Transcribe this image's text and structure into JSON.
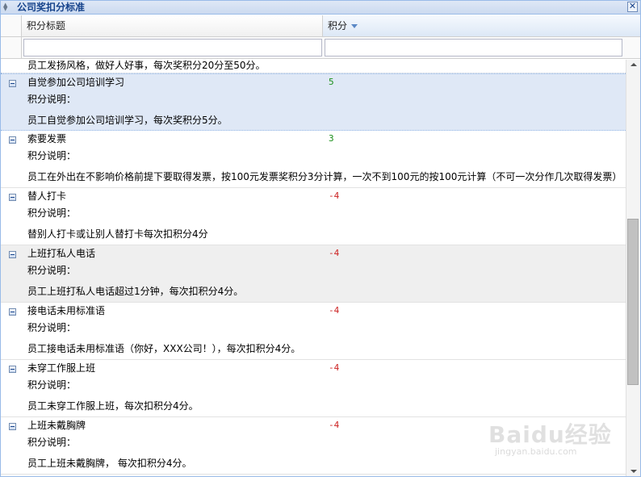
{
  "window": {
    "title": "公司奖扣分标准",
    "close_glyph": "✕"
  },
  "grid": {
    "columns": [
      {
        "label": "积分标题"
      },
      {
        "label": "积分",
        "sort": "descending"
      }
    ],
    "filters": {
      "title_value": "",
      "score_value": ""
    },
    "partial_row_desc": "员工发扬风格，做好人好事，每次奖积分20分至50分。",
    "detail_label": "积分说明：",
    "rows": [
      {
        "title": "自觉参加公司培训学习",
        "score": "5",
        "desc": "员工自觉参加公司培训学习，每次奖积分5分。",
        "selected": true
      },
      {
        "title": "索要发票",
        "score": "3",
        "desc": "员工在外出在不影响价格前提下要取得发票，按100元发票奖积分3分计算，一次不到100元的按100元计算（不可一次分作几次取得发票）"
      },
      {
        "title": "替人打卡",
        "score": "-4",
        "desc": "替别人打卡或让别人替打卡每次扣积分4分"
      },
      {
        "title": "上班打私人电话",
        "score": "-4",
        "desc": "员工上班打私人电话超过1分钟，每次扣积分4分。",
        "hovered": true
      },
      {
        "title": "接电话未用标准语",
        "score": "-4",
        "desc": "员工接电话未用标准语（你好，XXX公司！），每次扣积分4分。"
      },
      {
        "title": "未穿工作服上班",
        "score": "-4",
        "desc": "员工未穿工作服上班，每次扣积分4分。"
      },
      {
        "title": "上班未戴胸牌",
        "score": "-4",
        "desc": "员工上班未戴胸牌， 每次扣积分4分。"
      }
    ]
  },
  "scrollbar": {
    "position_fraction": 0.39
  },
  "watermark": {
    "text": "Baidu经验",
    "sub": "jingyan.baidu.com"
  },
  "colors": {
    "positive": "#1a8f1a",
    "negative": "#cc2222",
    "selected_row": "#dfe8f6",
    "title_text": "#15428b"
  }
}
